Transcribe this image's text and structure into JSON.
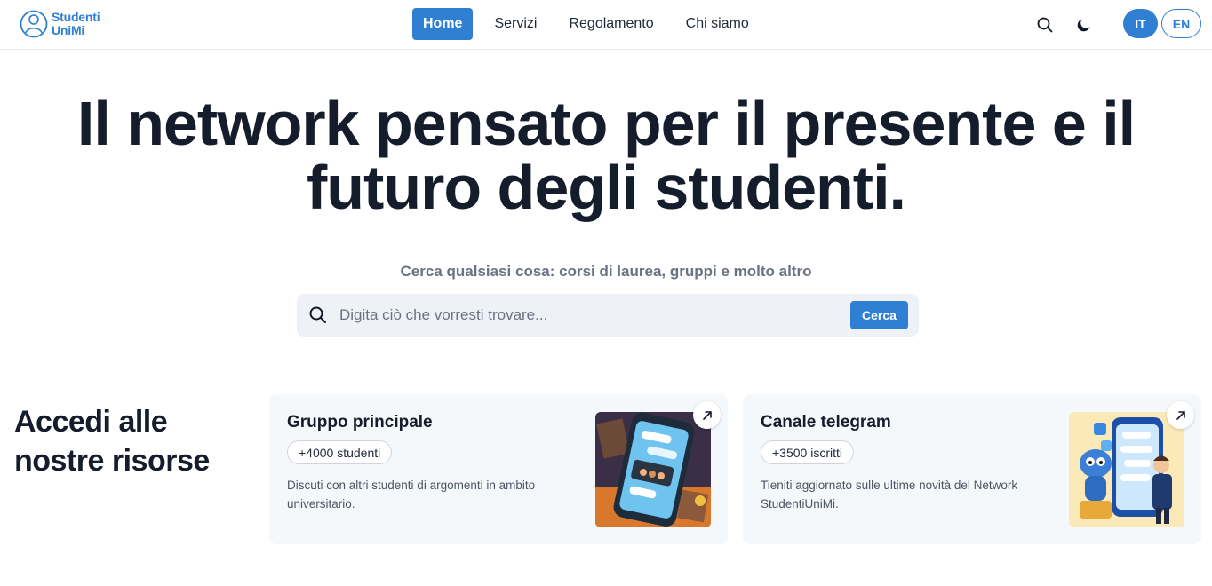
{
  "header": {
    "logo": {
      "line1": "Studenti",
      "line2": "UniMi",
      "icon": "student-logo-icon"
    },
    "nav": [
      {
        "label": "Home",
        "active": true
      },
      {
        "label": "Servizi",
        "active": false
      },
      {
        "label": "Regolamento",
        "active": false
      },
      {
        "label": "Chi siamo",
        "active": false
      }
    ],
    "search_icon": "search-icon",
    "theme_icon": "moon-icon",
    "languages": [
      {
        "label": "IT",
        "selected": true
      },
      {
        "label": "EN",
        "selected": false
      }
    ]
  },
  "hero": {
    "title_line1": "Il network pensato per il presente e il",
    "title_line2": "futuro degli studenti.",
    "search_caption": "Cerca qualsiasi cosa: corsi di laurea, gruppi e molto altro",
    "search_placeholder": "Digita ciò che vorresti trovare...",
    "search_button": "Cerca"
  },
  "resources": {
    "title_line1": "Accedi alle",
    "title_line2": "nostre risorse",
    "cards": [
      {
        "title": "Gruppo principale",
        "badge": "+4000 studenti",
        "description": "Discuti con altri studenti di argomenti in ambito universitario.",
        "image": "group-chat-illustration",
        "arrow_icon": "arrow-up-right-icon"
      },
      {
        "title": "Canale telegram",
        "badge": "+3500 iscritti",
        "description": "Tieniti aggiornato sulle ultime novità del Network StudentiUniMi.",
        "image": "telegram-channel-illustration",
        "arrow_icon": "arrow-up-right-icon"
      }
    ]
  },
  "colors": {
    "accent": "#2f7fd3",
    "text": "#151c2c",
    "muted": "#6b7280",
    "card_bg": "#f5f8fb",
    "search_bg": "#eef2f7"
  }
}
